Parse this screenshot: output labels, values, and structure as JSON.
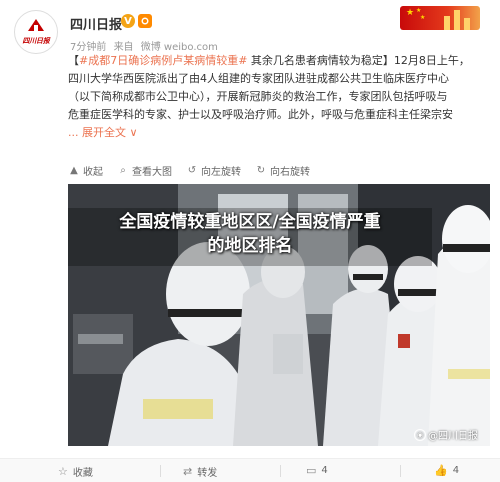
{
  "author": {
    "name": "四川日报",
    "verified_badge": "V",
    "avatar_text": "四川日报"
  },
  "meta": {
    "time": "7分钟前",
    "source_prefix": "来自",
    "source": "微博 weibo.com"
  },
  "post": {
    "topic": "#成都7日确诊病例卢某病情较重#",
    "line1_rest": " 其余几名患者病情较为稳定】12月8日上午，",
    "line2": "四川大学华西医院派出了由4人组建的专家团队进驻成都公共卫生临床医疗中心",
    "line3": "（以下简称成都市公卫中心），开展新冠肺炎的救治工作，专家团队包括呼吸与",
    "line4": "危重症医学科的专家、护士以及呼吸治疗师。此外，呼吸与危重症科主任梁宗安",
    "expand": "... 展开全文",
    "expand_chevron": "∨",
    "bracket_open": "【"
  },
  "media_toolbar": {
    "collect": "收起",
    "view_large": "查看大图",
    "rotate_left": "向左旋转",
    "rotate_right": "向右旋转"
  },
  "image": {
    "overlay_line1": "全国疫情较重地区区/全国疫情严重",
    "overlay_line2": "的地区排名",
    "watermark": "@四川日报"
  },
  "footer": {
    "favorite": "收藏",
    "repost": "转发",
    "comments": "4",
    "likes": "4"
  },
  "colors": {
    "link": "#eb7350",
    "verified": "#f4a416",
    "brand_red": "#c40000"
  },
  "icons": [
    "star-icon",
    "repost-icon",
    "comment-icon",
    "like-icon",
    "collapse-icon",
    "zoom-icon",
    "rotate-left-icon",
    "rotate-right-icon",
    "verified-icon",
    "medal-icon"
  ]
}
